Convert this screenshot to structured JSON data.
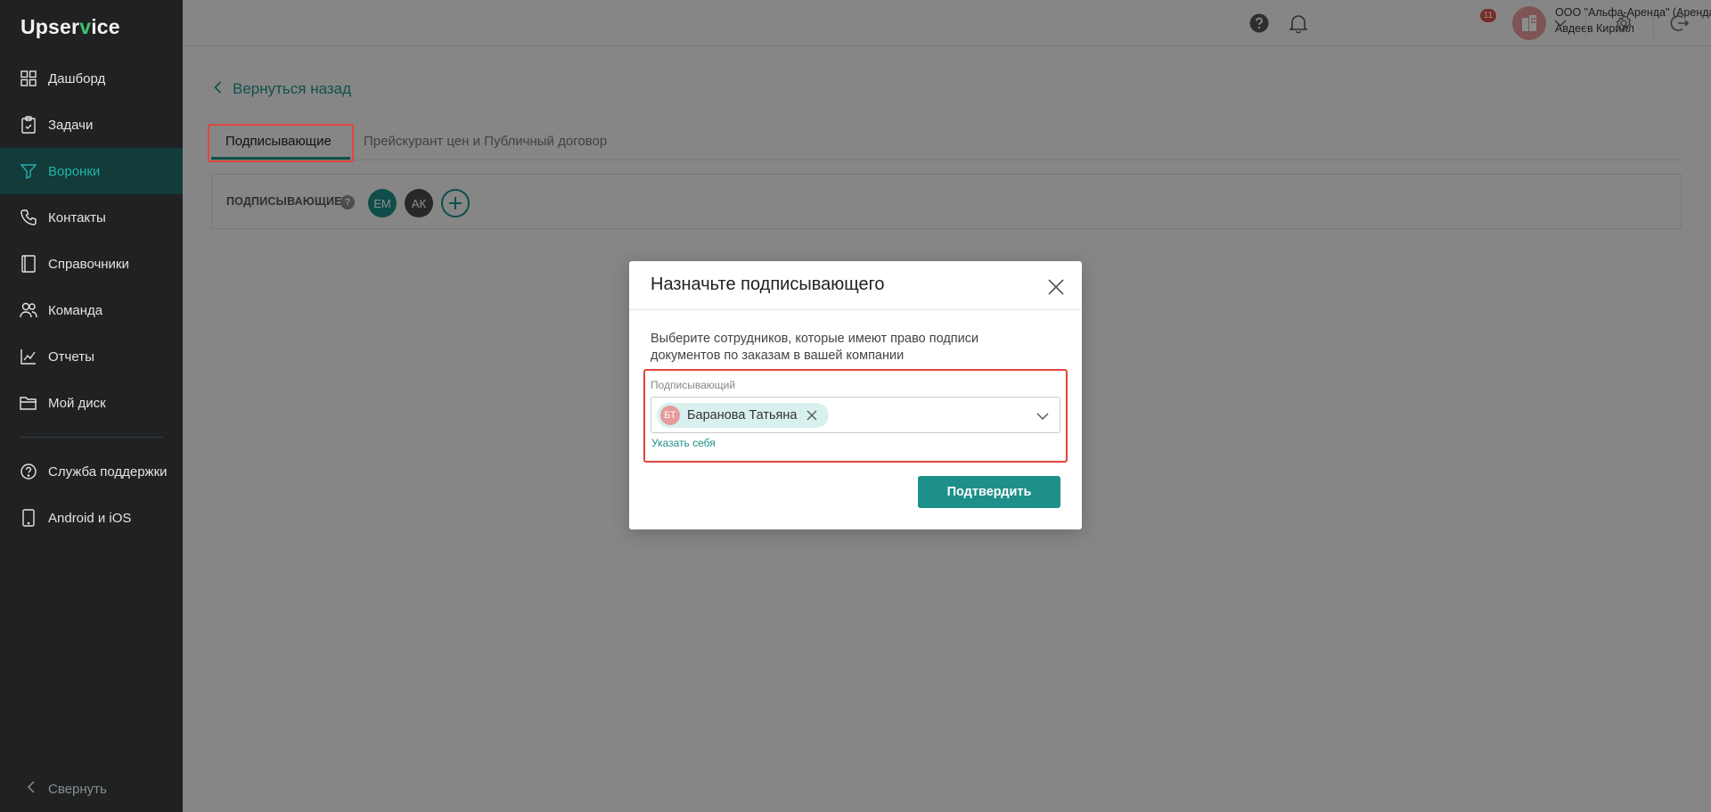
{
  "app": {
    "logo_prefix": "Upser",
    "logo_accent": "v",
    "logo_suffix": "ice"
  },
  "sidebar": {
    "items": [
      {
        "label": "Дашборд",
        "icon": "dashboard-icon",
        "active": false
      },
      {
        "label": "Задачи",
        "icon": "tasks-icon",
        "active": false
      },
      {
        "label": "Воронки",
        "icon": "funnel-icon",
        "active": true
      },
      {
        "label": "Контакты",
        "icon": "phone-icon",
        "active": false
      },
      {
        "label": "Справочники",
        "icon": "book-icon",
        "active": false
      },
      {
        "label": "Команда",
        "icon": "team-icon",
        "active": false
      },
      {
        "label": "Отчеты",
        "icon": "chart-icon",
        "active": false
      },
      {
        "label": "Мой диск",
        "icon": "folder-icon",
        "active": false
      }
    ],
    "bottom_items": [
      {
        "label": "Служба поддержки",
        "icon": "help-icon"
      },
      {
        "label": "Android и iOS",
        "icon": "mobile-icon"
      }
    ],
    "collapse_label": "Свернуть"
  },
  "header": {
    "notifications_count": "11",
    "company": "ООО \"Альфа-Аренда\" (Аренда)",
    "user": "Авдеев Кирилл"
  },
  "main": {
    "back_label": "Вернуться назад",
    "tabs": [
      {
        "label": "Подписывающие",
        "active": true
      },
      {
        "label": "Прейскурант цен и Публичный договор",
        "active": false
      }
    ],
    "signers_label": "ПОДПИСЫВАЮЩИЕ",
    "signers_help": "?",
    "signers": [
      {
        "initials": "ЕМ",
        "color": "#1e8f89"
      },
      {
        "initials": "АК",
        "color": "#4a4a4a"
      }
    ]
  },
  "modal": {
    "title": "Назначьте подписывающего",
    "description": "Выберите сотрудников, которые имеют право подписи документов по заказам в вашей компании",
    "field_label": "Подписывающий",
    "selected": [
      {
        "initials": "БТ",
        "name": "Баранова Татьяна"
      }
    ],
    "self_link": "Указать себя",
    "confirm_label": "Подтвердить"
  },
  "colors": {
    "accent": "#1e8f89",
    "sidebar_bg": "#1f2122",
    "highlight": "#e0463c"
  }
}
